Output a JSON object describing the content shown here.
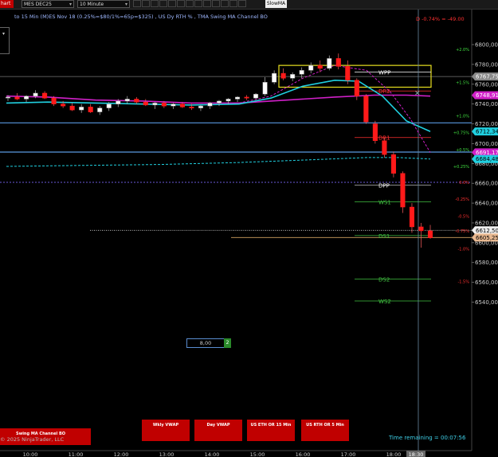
{
  "toolbar": {
    "chart_tab": "hart",
    "instrument": "MES DEC25",
    "interval": "10 Minute",
    "slowma_button": "SlowMA"
  },
  "chart_header": {
    "title_line": "to 15 Min (M)ES Nov 18 (0.25%=$80/1%=65p=$325) , US Dy RTH % , TMA Swing MA Channel BO",
    "pct_change": "D -0.74% = -49.00"
  },
  "price_axis": {
    "ticks": [
      "6800,00",
      "6780,00",
      "6760,00",
      "6740,00",
      "6720,00",
      "6700,00",
      "6680,00",
      "6660,00",
      "6640,00",
      "6620,00",
      "6600,00",
      "6580,00",
      "6560,00",
      "6540,00"
    ],
    "tick_values": [
      6800,
      6780,
      6760,
      6740,
      6720,
      6700,
      6680,
      6660,
      6640,
      6620,
      6600,
      6580,
      6560,
      6540
    ],
    "markers": [
      {
        "label": "6767,75",
        "value": 6767.75,
        "color": "#8a8a8a",
        "text": "#fff"
      },
      {
        "label": "6748,91",
        "value": 6748.91,
        "color": "#d020c8",
        "text": "#fff"
      },
      {
        "label": "6712,34",
        "value": 6712.34,
        "color": "#20d0e0",
        "text": "#000"
      },
      {
        "label": "6691,17",
        "value": 6691.17,
        "color": "#d020c8",
        "text": "#fff"
      },
      {
        "label": "6684,48",
        "value": 6684.48,
        "color": "#20d0e0",
        "text": "#000"
      },
      {
        "label": "6612,50",
        "value": 6612.5,
        "color": "#f0f0f0",
        "text": "#000"
      },
      {
        "label": "6605,25",
        "value": 6605.25,
        "color": "#e8b890",
        "text": "#000"
      }
    ]
  },
  "percent_levels": [
    {
      "label": "+2.0%",
      "value": 6795,
      "color": "#40e040"
    },
    {
      "label": "+1.5%",
      "value": 6762,
      "color": "#40e040"
    },
    {
      "label": "+1.0%",
      "value": 6728,
      "color": "#40e040"
    },
    {
      "label": "+0.75%",
      "value": 6711,
      "color": "#40e040"
    },
    {
      "label": "+0.5%",
      "value": 6694,
      "color": "#40e040"
    },
    {
      "label": "+0.25%",
      "value": 6677,
      "color": "#40e040"
    },
    {
      "label": "0.0%",
      "value": 6661,
      "color": "#ff3030"
    },
    {
      "label": "-0.25%",
      "value": 6644,
      "color": "#ff3030"
    },
    {
      "label": "-0.5%",
      "value": 6627,
      "color": "#ff3030"
    },
    {
      "label": "-0.75%",
      "value": 6612,
      "color": "#ff3030"
    },
    {
      "label": "-1.0%",
      "value": 6594,
      "color": "#ff3030"
    },
    {
      "label": "-1.5%",
      "value": 6561,
      "color": "#ff3030"
    }
  ],
  "pivot_labels": [
    {
      "label": "WPP",
      "value": 6773,
      "color": "#ffffff"
    },
    {
      "label": "DR2",
      "value": 6754,
      "color": "#ff3030"
    },
    {
      "label": "DR1",
      "value": 6707,
      "color": "#ff3030"
    },
    {
      "label": "DPP",
      "value": 6659,
      "color": "#ffffff"
    },
    {
      "label": "WS1",
      "value": 6642,
      "color": "#40c040"
    },
    {
      "label": "DS1",
      "value": 6608,
      "color": "#40c040"
    },
    {
      "label": "DS2",
      "value": 6564,
      "color": "#40c040"
    },
    {
      "label": "WS2",
      "value": 6542,
      "color": "#40c040"
    }
  ],
  "time_axis": {
    "labels": [
      "10:00",
      "11:00",
      "12:00",
      "13:00",
      "14:00",
      "15:00",
      "16:00",
      "17:00",
      "18:00",
      "18:30"
    ],
    "highlight": "18:30"
  },
  "candles": {
    "ohlc": [
      [
        6746,
        6749,
        6743,
        6747
      ],
      [
        6747,
        6751,
        6744,
        6745
      ],
      [
        6745,
        6749,
        6742,
        6748
      ],
      [
        6748,
        6754,
        6746,
        6751
      ],
      [
        6751,
        6753,
        6745,
        6746
      ],
      [
        6746,
        6748,
        6738,
        6740
      ],
      [
        6740,
        6743,
        6736,
        6738
      ],
      [
        6738,
        6741,
        6733,
        6734
      ],
      [
        6734,
        6740,
        6731,
        6737
      ],
      [
        6737,
        6740,
        6731,
        6732
      ],
      [
        6732,
        6738,
        6729,
        6736
      ],
      [
        6736,
        6742,
        6733,
        6740
      ],
      [
        6740,
        6745,
        6737,
        6743
      ],
      [
        6743,
        6748,
        6740,
        6745
      ],
      [
        6745,
        6747,
        6740,
        6742
      ],
      [
        6742,
        6745,
        6738,
        6739
      ],
      [
        6739,
        6742,
        6735,
        6741
      ],
      [
        6741,
        6743,
        6736,
        6738
      ],
      [
        6738,
        6741,
        6735,
        6740
      ],
      [
        6740,
        6742,
        6736,
        6737
      ],
      [
        6737,
        6740,
        6734,
        6736
      ],
      [
        6736,
        6739,
        6733,
        6738
      ],
      [
        6738,
        6742,
        6735,
        6741
      ],
      [
        6741,
        6744,
        6738,
        6743
      ],
      [
        6743,
        6746,
        6740,
        6745
      ],
      [
        6745,
        6748,
        6742,
        6747
      ],
      [
        6747,
        6749,
        6744,
        6746
      ],
      [
        6746,
        6751,
        6745,
        6750
      ],
      [
        6750,
        6767,
        6748,
        6762
      ],
      [
        6762,
        6774,
        6760,
        6771
      ],
      [
        6771,
        6776,
        6764,
        6766
      ],
      [
        6766,
        6772,
        6763,
        6770
      ],
      [
        6770,
        6777,
        6766,
        6774
      ],
      [
        6774,
        6782,
        6771,
        6779
      ],
      [
        6779,
        6784,
        6772,
        6776
      ],
      [
        6776,
        6789,
        6774,
        6786
      ],
      [
        6786,
        6791,
        6775,
        6778
      ],
      [
        6778,
        6784,
        6760,
        6764
      ],
      [
        6764,
        6766,
        6744,
        6748
      ],
      [
        6748,
        6750,
        6720,
        6722
      ],
      [
        6720,
        6723,
        6700,
        6703
      ],
      [
        6703,
        6706,
        6686,
        6689
      ],
      [
        6689,
        6692,
        6666,
        6670
      ],
      [
        6670,
        6672,
        6630,
        6636
      ],
      [
        6636,
        6640,
        6610,
        6616
      ],
      [
        6616,
        6620,
        6595,
        6612
      ],
      [
        6612,
        6618,
        6604,
        6605
      ]
    ],
    "bull_color": "#ffffff",
    "bear_color": "#ff1a1a"
  },
  "order": {
    "price": "8,00",
    "quantity": "2"
  },
  "bottom_buttons": {
    "swing": "Swing MA Channel BO",
    "wkly_vwap": "Wkly VWAP",
    "day_vwap": "Day VWAP",
    "us_eth_or": "US ETH OR 15 Min",
    "us_rth_or": "US RTH OR 5 Min"
  },
  "copyright": "© 2025 NinjaTrader, LLC",
  "time_remaining": "Time remaining = 00:07:56"
}
